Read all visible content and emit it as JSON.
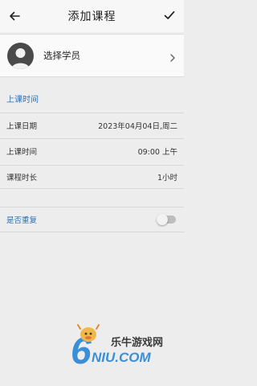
{
  "header": {
    "title": "添加课程",
    "back_icon": "arrow-left-icon",
    "confirm_icon": "check-icon"
  },
  "student": {
    "label": "选择学员",
    "avatar_icon": "person-icon",
    "chevron_icon": "chevron-right-icon"
  },
  "schedule": {
    "section_title": "上课时间",
    "rows": [
      {
        "label": "上课日期",
        "value": "2023年04月04日,周二"
      },
      {
        "label": "上课时间",
        "value": "09:00 上午"
      },
      {
        "label": "课程时长",
        "value": "1小时"
      }
    ]
  },
  "repeat": {
    "label": "是否重复",
    "enabled": false
  },
  "watermark": {
    "logo_digit": "6",
    "brand_text": "乐牛游戏网",
    "domain_text": "NIU.COM"
  },
  "colors": {
    "accent": "#2a6fb7",
    "background": "#ededed"
  }
}
